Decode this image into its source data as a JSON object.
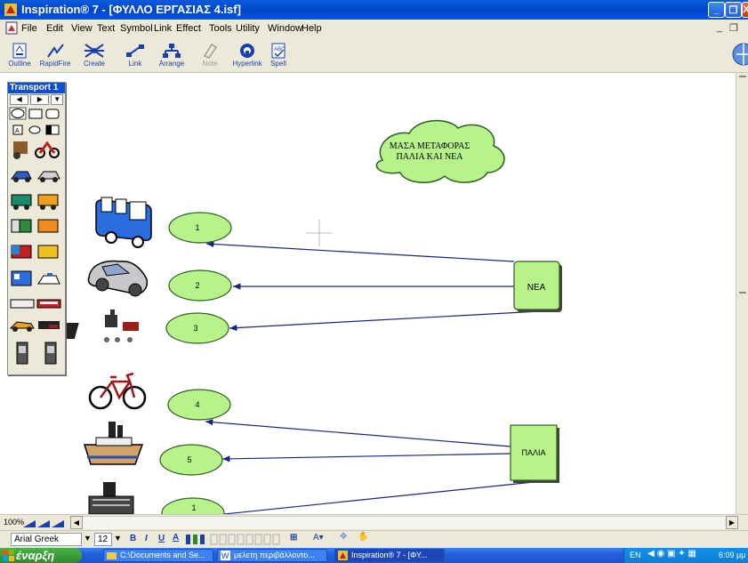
{
  "window": {
    "title": "Inspiration® 7 - [ΦΥΛΛΟ ΕΡΓΑΣΙΑΣ 4.isf]",
    "controls": [
      "minimize",
      "restore",
      "close"
    ]
  },
  "menubar": {
    "items": [
      "File",
      "Edit",
      "View",
      "Text",
      "Symbol",
      "Link",
      "Effect",
      "Tools",
      "Utility",
      "Window",
      "Help"
    ]
  },
  "toolbar": {
    "tools": [
      {
        "label": "Outline",
        "icon": "outline-icon",
        "enabled": true
      },
      {
        "label": "RapidFire",
        "icon": "rapidfire-icon",
        "enabled": true
      },
      {
        "label": "Create",
        "icon": "create-icon",
        "enabled": true
      },
      {
        "label": "Link",
        "icon": "link-icon",
        "enabled": true
      },
      {
        "label": "Arrange",
        "icon": "arrange-icon",
        "enabled": true
      },
      {
        "label": "Note",
        "icon": "note-icon",
        "enabled": false
      },
      {
        "label": "Hyperlink",
        "icon": "hyperlink-icon",
        "enabled": true
      },
      {
        "label": "Spell",
        "icon": "spell-icon",
        "enabled": true
      }
    ]
  },
  "palette": {
    "title": "Transport 1"
  },
  "diagram": {
    "cloud_title": "ΜΑΣΑ ΜΕΤΑΦΟΡΑΣ\nΠΑΛΙΑ ΚΑΙ ΝΕΑ",
    "cloud_line1": "ΜΑΣΑ ΜΕΤΑΦΟΡΑΣ",
    "cloud_line2": "ΠΑΛΙΑ ΚΑΙ ΝΕΑ",
    "box_new": "ΝΕΑ",
    "box_old": "ΠΑΛΙΑ",
    "ovals": [
      "1",
      "2",
      "3",
      "4",
      "5",
      "1"
    ],
    "symbols": [
      "bus-icon",
      "car-icon",
      "train-icon",
      "bicycle-icon",
      "steamship-icon",
      "ship-icon"
    ],
    "colors": {
      "shape_fill": "#b8f28a",
      "link": "#1a237e"
    }
  },
  "statusbar": {
    "zoom": "100%"
  },
  "formatbar": {
    "font": "Arial Greek",
    "size": "12",
    "bold": "B",
    "italic": "I",
    "underline": "U"
  },
  "taskbar": {
    "start": "έναρξη",
    "items": [
      {
        "label": "C:\\Documents and Se...",
        "active": false
      },
      {
        "label": "μελετη περιβάλλοντο...",
        "active": false
      },
      {
        "label": "Inspiration® 7 - [ΦΥ...",
        "active": true
      }
    ],
    "lang": "EN",
    "clock": "6:09 μμ"
  }
}
